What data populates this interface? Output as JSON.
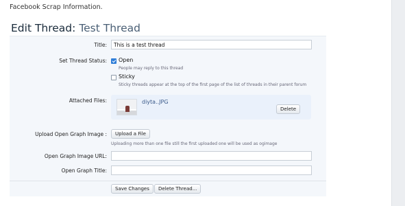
{
  "page": {
    "top_text": "Facebook Scrap Information."
  },
  "header": {
    "title_prefix": "Edit Thread:",
    "thread_name": "Test Thread"
  },
  "form": {
    "title": {
      "label": "Title:",
      "value": "This is a test thread"
    },
    "status": {
      "label": "Set Thread Status:",
      "open": {
        "label": "Open",
        "help": "People may reply to this thread",
        "checked": true
      },
      "sticky": {
        "label": "Sticky",
        "help": "Sticky threads appear at the top of the first page of the list of threads in their parent forum",
        "checked": false
      }
    },
    "attached": {
      "label": "Attached Files:",
      "file_name": "diyta..JPG",
      "delete_label": "Delete"
    },
    "upload": {
      "label": "Upload Open Graph Image :",
      "button_label": "Upload a File",
      "help": "Uploading more than one file still the first uploaded one will be used as ogimage"
    },
    "og_image_url": {
      "label": "Open Graph Image URL:",
      "value": ""
    },
    "og_title": {
      "label": "Open Graph Title:",
      "value": ""
    },
    "buttons": {
      "save": "Save Changes",
      "delete_thread": "Delete Thread..."
    }
  },
  "colors": {
    "accent": "#2f7ed8",
    "panel_bg": "#f4f7fb",
    "files_bg": "#eaf1fb"
  }
}
